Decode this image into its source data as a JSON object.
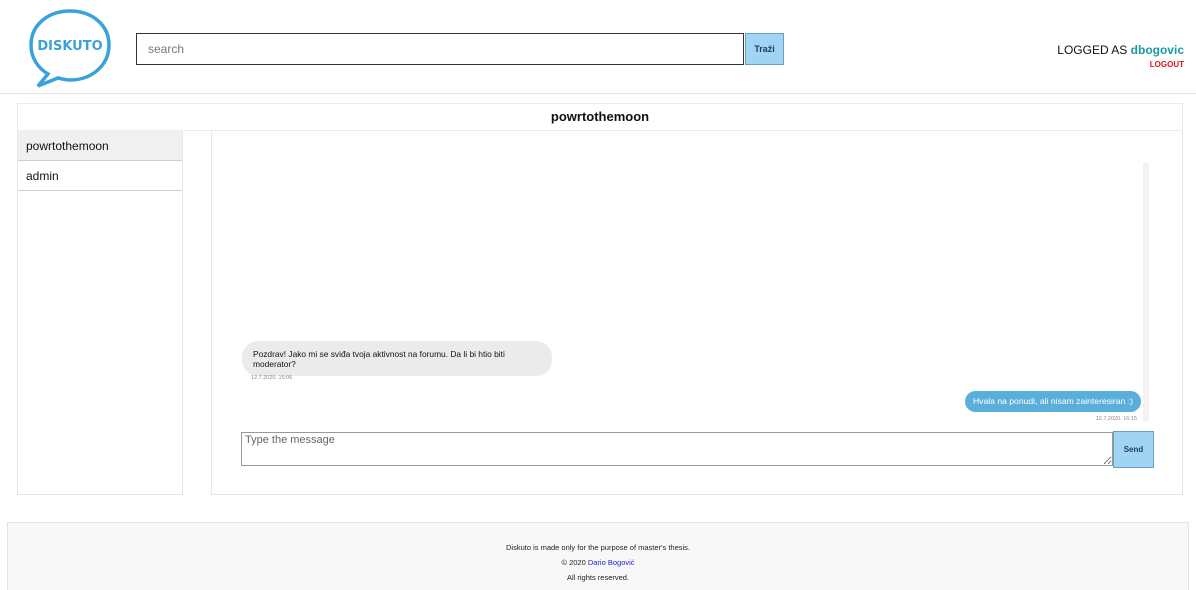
{
  "brand": {
    "logo_text": "DISKUTO",
    "brand_color": "#3aa2da"
  },
  "header": {
    "search_placeholder": "search",
    "search_button": "Traži",
    "logged_as_label": "LOGGED AS",
    "username": "dbogovic",
    "logout_label": "LOGOUT"
  },
  "conversation": {
    "title": "powrtothemoon"
  },
  "sidebar": {
    "items": [
      {
        "label": "powrtothemoon",
        "active": true
      },
      {
        "label": "admin",
        "active": false
      }
    ]
  },
  "chat": {
    "messages": [
      {
        "direction": "received",
        "text": "Pozdrav! Jako mi se sviđa tvoja aktivnost na forumu. Da li bi htio biti moderator?",
        "time": "12.7.2020. 16:06"
      },
      {
        "direction": "sent",
        "text": "Hvala na ponudi, ali nisam zainteresiran :)",
        "time": "12.7.2020. 16:15"
      }
    ],
    "input_placeholder": "Type the message",
    "send_label": "Send"
  },
  "footer": {
    "line1": "Diskuto is made only for the purpose of master's thesis.",
    "copyright_prefix": "© 2020",
    "author": "Dario Bogović",
    "line3": "All rights reserved."
  },
  "colors": {
    "accent_button": "#9fd4f5",
    "sent_bubble": "#5aaedc",
    "received_bubble": "#ebebeb",
    "username": "#1b9aa1",
    "logout": "#e0141b",
    "footer_link": "#2222cc"
  }
}
